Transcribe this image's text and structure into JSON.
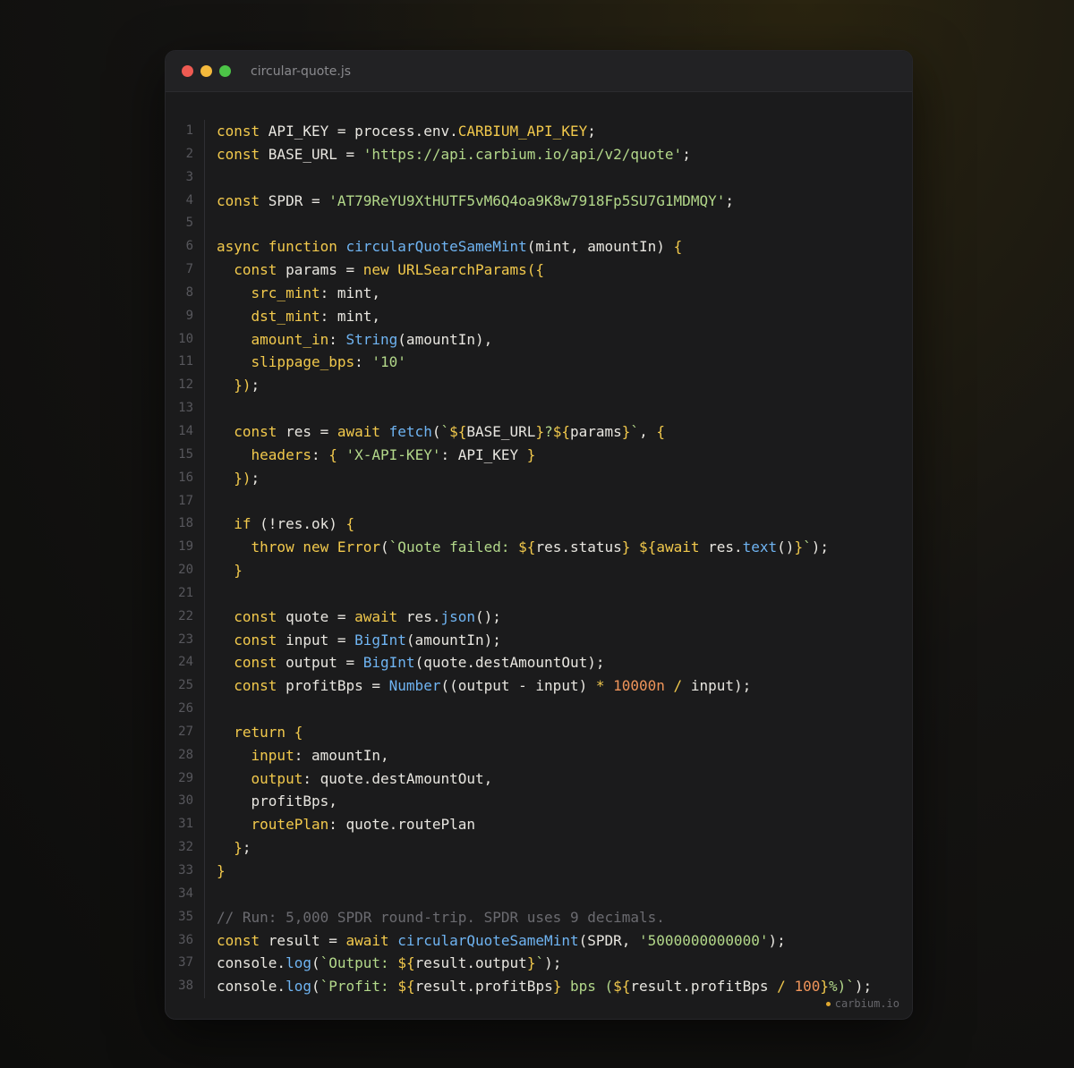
{
  "window": {
    "filename": "circular-quote.js",
    "traffic_lights": [
      {
        "name": "close",
        "color": "#ee5a52"
      },
      {
        "name": "minimize",
        "color": "#f4b93c"
      },
      {
        "name": "maximize",
        "color": "#4cc447"
      }
    ]
  },
  "colors": {
    "keyword": "#f2c94c",
    "function": "#6fb4f2",
    "string": "#b3d88a",
    "number": "#f0955a",
    "comment": "#6b6b70",
    "text": "#e8e6e0"
  },
  "code": {
    "lines": [
      [
        [
          "kw",
          "const "
        ],
        [
          "txt",
          "API_KEY = process.env."
        ],
        [
          "kw",
          "CARBIUM_API_KEY"
        ],
        [
          "txt",
          ";"
        ]
      ],
      [
        [
          "kw",
          "const "
        ],
        [
          "txt",
          "BASE_URL = "
        ],
        [
          "str",
          "'https://api.carbium.io/api/v2/quote'"
        ],
        [
          "txt",
          ";"
        ]
      ],
      [],
      [
        [
          "kw",
          "const "
        ],
        [
          "txt",
          "SPDR = "
        ],
        [
          "str",
          "'AT79ReYU9XtHUTF5vM6Q4oa9K8w7918Fp5SU7G1MDMQY'"
        ],
        [
          "txt",
          ";"
        ]
      ],
      [],
      [
        [
          "kw",
          "async function "
        ],
        [
          "fn",
          "circularQuoteSameMint"
        ],
        [
          "txt",
          "(mint, amountIn) "
        ],
        [
          "kw",
          "{"
        ]
      ],
      [
        [
          "txt",
          "  "
        ],
        [
          "kw",
          "const "
        ],
        [
          "txt",
          "params = "
        ],
        [
          "kw",
          "new "
        ],
        [
          "kw",
          "URLSearchParams"
        ],
        [
          "kw",
          "({"
        ]
      ],
      [
        [
          "txt",
          "    "
        ],
        [
          "kw",
          "src_mint"
        ],
        [
          "txt",
          ": mint,"
        ]
      ],
      [
        [
          "txt",
          "    "
        ],
        [
          "kw",
          "dst_mint"
        ],
        [
          "txt",
          ": mint,"
        ]
      ],
      [
        [
          "txt",
          "    "
        ],
        [
          "kw",
          "amount_in"
        ],
        [
          "txt",
          ": "
        ],
        [
          "fn",
          "String"
        ],
        [
          "txt",
          "(amountIn),"
        ]
      ],
      [
        [
          "txt",
          "    "
        ],
        [
          "kw",
          "slippage_bps"
        ],
        [
          "txt",
          ": "
        ],
        [
          "str",
          "'10'"
        ]
      ],
      [
        [
          "txt",
          "  "
        ],
        [
          "kw",
          "})"
        ],
        [
          "txt",
          ";"
        ]
      ],
      [],
      [
        [
          "txt",
          "  "
        ],
        [
          "kw",
          "const "
        ],
        [
          "txt",
          "res = "
        ],
        [
          "kw",
          "await "
        ],
        [
          "fn",
          "fetch"
        ],
        [
          "txt",
          "("
        ],
        [
          "str",
          "`"
        ],
        [
          "kw",
          "${"
        ],
        [
          "txt",
          "BASE_URL"
        ],
        [
          "kw",
          "}"
        ],
        [
          "str",
          "?"
        ],
        [
          "kw",
          "${"
        ],
        [
          "txt",
          "params"
        ],
        [
          "kw",
          "}"
        ],
        [
          "str",
          "`"
        ],
        [
          "txt",
          ", "
        ],
        [
          "kw",
          "{"
        ]
      ],
      [
        [
          "txt",
          "    "
        ],
        [
          "kw",
          "headers"
        ],
        [
          "txt",
          ": "
        ],
        [
          "kw",
          "{ "
        ],
        [
          "str",
          "'X-API-KEY'"
        ],
        [
          "txt",
          ": API_KEY "
        ],
        [
          "kw",
          "}"
        ]
      ],
      [
        [
          "txt",
          "  "
        ],
        [
          "kw",
          "})"
        ],
        [
          "txt",
          ";"
        ]
      ],
      [],
      [
        [
          "txt",
          "  "
        ],
        [
          "kw",
          "if "
        ],
        [
          "txt",
          "(!res.ok) "
        ],
        [
          "kw",
          "{"
        ]
      ],
      [
        [
          "txt",
          "    "
        ],
        [
          "kw",
          "throw new "
        ],
        [
          "kw",
          "Error"
        ],
        [
          "txt",
          "("
        ],
        [
          "str",
          "`Quote failed: "
        ],
        [
          "kw",
          "${"
        ],
        [
          "txt",
          "res.status"
        ],
        [
          "kw",
          "}"
        ],
        [
          "str",
          " "
        ],
        [
          "kw",
          "${await "
        ],
        [
          "txt",
          "res."
        ],
        [
          "fn",
          "text"
        ],
        [
          "txt",
          "()"
        ],
        [
          "kw",
          "}"
        ],
        [
          "str",
          "`"
        ],
        [
          "txt",
          ");"
        ]
      ],
      [
        [
          "txt",
          "  "
        ],
        [
          "kw",
          "}"
        ]
      ],
      [],
      [
        [
          "txt",
          "  "
        ],
        [
          "kw",
          "const "
        ],
        [
          "txt",
          "quote = "
        ],
        [
          "kw",
          "await "
        ],
        [
          "txt",
          "res."
        ],
        [
          "fn",
          "json"
        ],
        [
          "txt",
          "();"
        ]
      ],
      [
        [
          "txt",
          "  "
        ],
        [
          "kw",
          "const "
        ],
        [
          "txt",
          "input = "
        ],
        [
          "fn",
          "BigInt"
        ],
        [
          "txt",
          "(amountIn);"
        ]
      ],
      [
        [
          "txt",
          "  "
        ],
        [
          "kw",
          "const "
        ],
        [
          "txt",
          "output = "
        ],
        [
          "fn",
          "BigInt"
        ],
        [
          "txt",
          "(quote.destAmountOut);"
        ]
      ],
      [
        [
          "txt",
          "  "
        ],
        [
          "kw",
          "const "
        ],
        [
          "txt",
          "profitBps = "
        ],
        [
          "fn",
          "Number"
        ],
        [
          "txt",
          "((output - input) "
        ],
        [
          "kw",
          "* "
        ],
        [
          "num",
          "10000n"
        ],
        [
          "kw",
          " / "
        ],
        [
          "txt",
          "input);"
        ]
      ],
      [],
      [
        [
          "txt",
          "  "
        ],
        [
          "kw",
          "return {"
        ]
      ],
      [
        [
          "txt",
          "    "
        ],
        [
          "kw",
          "input"
        ],
        [
          "txt",
          ": amountIn,"
        ]
      ],
      [
        [
          "txt",
          "    "
        ],
        [
          "kw",
          "output"
        ],
        [
          "txt",
          ": quote.destAmountOut,"
        ]
      ],
      [
        [
          "txt",
          "    profitBps,"
        ]
      ],
      [
        [
          "txt",
          "    "
        ],
        [
          "kw",
          "routePlan"
        ],
        [
          "txt",
          ": quote.routePlan"
        ]
      ],
      [
        [
          "txt",
          "  "
        ],
        [
          "kw",
          "}"
        ],
        [
          "txt",
          ";"
        ]
      ],
      [
        [
          "kw",
          "}"
        ]
      ],
      [],
      [
        [
          "cm",
          "// Run: 5,000 SPDR round-trip. SPDR uses 9 decimals."
        ]
      ],
      [
        [
          "kw",
          "const "
        ],
        [
          "txt",
          "result = "
        ],
        [
          "kw",
          "await "
        ],
        [
          "fn",
          "circularQuoteSameMint"
        ],
        [
          "txt",
          "(SPDR, "
        ],
        [
          "str",
          "'5000000000000'"
        ],
        [
          "txt",
          ");"
        ]
      ],
      [
        [
          "txt",
          "console."
        ],
        [
          "fn",
          "log"
        ],
        [
          "txt",
          "("
        ],
        [
          "str",
          "`Output: "
        ],
        [
          "kw",
          "${"
        ],
        [
          "txt",
          "result.output"
        ],
        [
          "kw",
          "}"
        ],
        [
          "str",
          "`"
        ],
        [
          "txt",
          ");"
        ]
      ],
      [
        [
          "txt",
          "console."
        ],
        [
          "fn",
          "log"
        ],
        [
          "txt",
          "("
        ],
        [
          "str",
          "`Profit: "
        ],
        [
          "kw",
          "${"
        ],
        [
          "txt",
          "result.profitBps"
        ],
        [
          "kw",
          "}"
        ],
        [
          "str",
          " bps ("
        ],
        [
          "kw",
          "${"
        ],
        [
          "txt",
          "result.profitBps "
        ],
        [
          "kw",
          "/ "
        ],
        [
          "num",
          "100"
        ],
        [
          "kw",
          "}"
        ],
        [
          "str",
          "%)`"
        ],
        [
          "txt",
          ");"
        ]
      ]
    ]
  },
  "brand": {
    "label": "carbium.io",
    "dot_color": "#e0a830"
  }
}
